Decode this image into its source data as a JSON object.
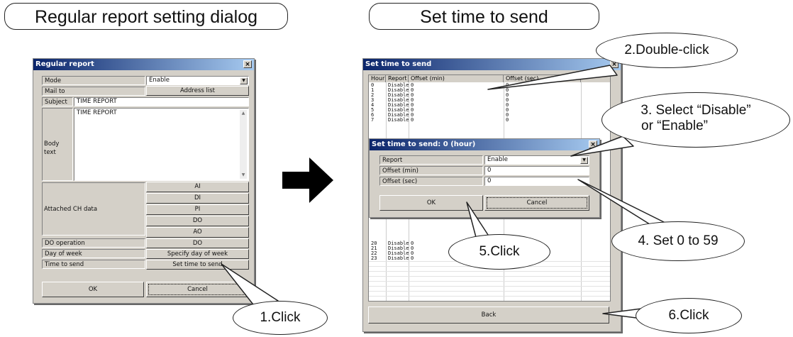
{
  "headers": {
    "left": "Regular report setting dialog",
    "right": "Set time to send"
  },
  "regular_dialog": {
    "title": "Regular report",
    "mode_label": "Mode",
    "mode_value": "Enable",
    "mail_to_label": "Mail to",
    "address_list_button": "Address list",
    "subject_label": "Subject",
    "subject_value": "TIME REPORT",
    "body_label": "Body text",
    "body_value": "TIME REPORT",
    "attached_label": "Attached CH data",
    "ch_buttons": [
      "AI",
      "DI",
      "PI",
      "DO",
      "AO"
    ],
    "do_operation_label": "DO operation",
    "do_button": "DO",
    "day_of_week_label": "Day of week",
    "day_of_week_button": "Specify day of week",
    "time_to_send_label": "Time to send",
    "time_to_send_button": "Set time to send",
    "ok_button": "OK",
    "cancel_button": "Cancel"
  },
  "time_dialog": {
    "title": "Set time to send",
    "columns": [
      "Hour",
      "Report",
      "Offset (min)",
      "Offset (sec)"
    ],
    "rows_top": [
      [
        "0",
        "Disable",
        "0",
        "0"
      ],
      [
        "1",
        "Disable",
        "0",
        "0"
      ],
      [
        "2",
        "Disable",
        "0",
        "0"
      ],
      [
        "3",
        "Disable",
        "0",
        "0"
      ],
      [
        "4",
        "Disable",
        "0",
        "0"
      ],
      [
        "5",
        "Disable",
        "0",
        "0"
      ],
      [
        "6",
        "Disable",
        "0",
        "0"
      ],
      [
        "7",
        "Disable",
        "0",
        "0"
      ]
    ],
    "rows_bottom": [
      [
        "20",
        "Disable",
        "0",
        "0"
      ],
      [
        "21",
        "Disable",
        "0",
        "0"
      ],
      [
        "22",
        "Disable",
        "0",
        "0"
      ],
      [
        "23",
        "Disable",
        "0",
        "0"
      ]
    ],
    "back_button": "Back"
  },
  "hour_dialog": {
    "title": "Set time to send: 0 (hour)",
    "report_label": "Report",
    "report_value": "Enable",
    "offset_min_label": "Offset (min)",
    "offset_min_value": "0",
    "offset_sec_label": "Offset (sec)",
    "offset_sec_value": "0",
    "ok_button": "OK",
    "cancel_button": "Cancel"
  },
  "callouts": {
    "c1": "1.Click",
    "c2": "2.Double-click",
    "c3_line1": "3. Select “Disable”",
    "c3_line2": "or “Enable”",
    "c4": "4. Set 0 to 59",
    "c5": "5.Click",
    "c6": "6.Click"
  }
}
